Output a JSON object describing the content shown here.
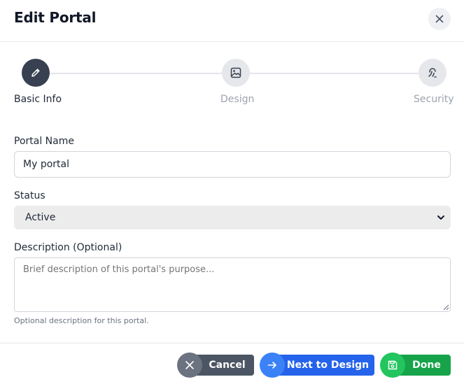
{
  "header": {
    "title": "Edit Portal",
    "close_icon": "close-icon"
  },
  "steps": [
    {
      "label": "Basic Info",
      "icon": "pencil-icon",
      "state": "active"
    },
    {
      "label": "Design",
      "icon": "image-icon",
      "state": "inactive"
    },
    {
      "label": "Security",
      "icon": "fingerprint-icon",
      "state": "inactive"
    }
  ],
  "form": {
    "portal_name": {
      "label": "Portal Name",
      "value": "My portal"
    },
    "status": {
      "label": "Status",
      "value": "Active"
    },
    "description": {
      "label": "Description (Optional)",
      "placeholder": "Brief description of this portal's purpose...",
      "help": "Optional description for this portal."
    }
  },
  "footer": {
    "cancel": {
      "label": "Cancel",
      "icon": "x-icon",
      "color": "#4b5563"
    },
    "next": {
      "label": "Next to Design",
      "icon": "arrow-right-icon",
      "color": "#2563eb"
    },
    "done": {
      "label": "Done",
      "icon": "save-icon",
      "color": "#16a34a"
    }
  },
  "colors": {
    "accent_dark": "#374151",
    "primary": "#2563eb",
    "success": "#16a34a"
  }
}
